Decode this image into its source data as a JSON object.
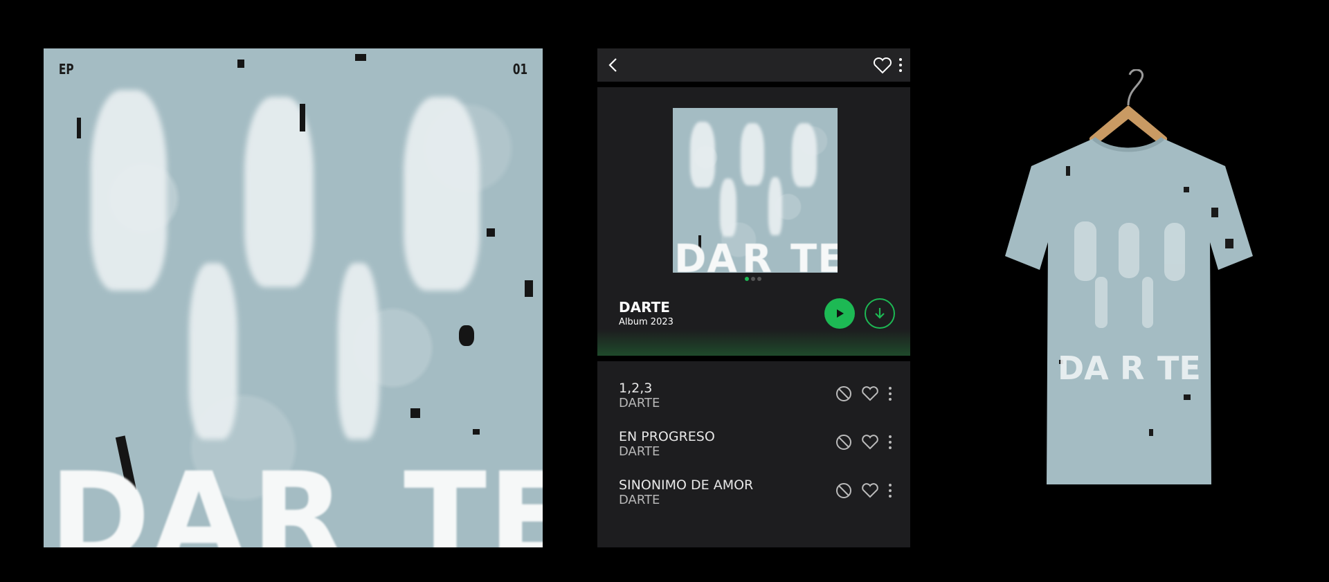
{
  "cover": {
    "corner_left": "EP",
    "corner_right": "01",
    "title_parts": [
      "DA",
      "R",
      "TE"
    ]
  },
  "header": {
    "back_icon": "chevron-left-icon",
    "favorite_icon": "heart-outline-icon",
    "menu_icon": "vertical-dots-icon"
  },
  "album": {
    "thumb_title_parts": [
      "DA",
      "R",
      "TE"
    ],
    "page_indicator": {
      "count": 3,
      "active_index": 0
    },
    "title": "DARTE",
    "subtitle": "Album 2023",
    "play_icon": "play-icon",
    "download_icon": "download-arrow-icon"
  },
  "tracks": [
    {
      "title": "1,2,3",
      "artist": "DARTE"
    },
    {
      "title": "EN PROGRESO",
      "artist": "DARTE"
    },
    {
      "title": "SINONIMO DE AMOR",
      "artist": "DARTE"
    }
  ],
  "track_icons": [
    "block-icon",
    "heart-outline-icon",
    "vertical-dots-icon"
  ],
  "shirt": {
    "title_parts": [
      "DA",
      "R",
      "TE"
    ]
  },
  "colors": {
    "background": "#000000",
    "panel": "#1d1d1f",
    "accent_green": "#1db954",
    "cover_blue": "#a4bcc3"
  }
}
